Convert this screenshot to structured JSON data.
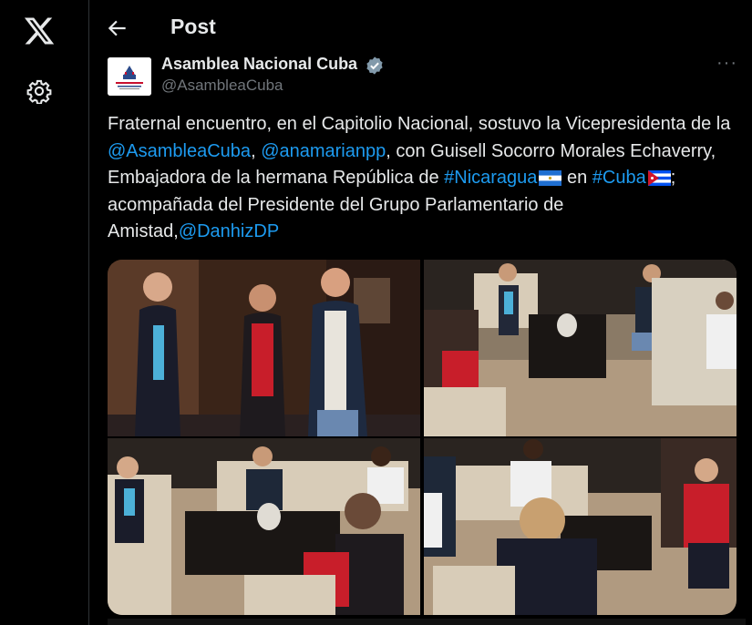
{
  "nav": {
    "logo_icon": "x-logo-icon",
    "settings_icon": "gear-icon"
  },
  "header": {
    "back_icon": "arrow-left-icon",
    "title": "Post"
  },
  "author": {
    "name": "Asamblea Nacional Cuba",
    "handle": "@AsambleaCuba",
    "verified_icon": "verified-badge-icon",
    "avatar_icon": "asamblea-logo-icon"
  },
  "more_label": "···",
  "tweet": {
    "t1": "Fraternal encuentro, en el Capitolio Nacional, sostuvo la Vicepresidenta de la ",
    "m1": "@AsambleaCuba",
    "t2": ", ",
    "m2": "@anamarianpp",
    "t3": ", con Guisell Socorro Morales Echaverry, Embajadora de la hermana República de ",
    "h1": "#Nicaragua",
    "t4": " en ",
    "h2": "#Cuba",
    "t5": "; acompañada del Presidente del Grupo Parlamentario de Amistad,",
    "m3": "@DanhizDP"
  },
  "colors": {
    "link": "#1d9bf0",
    "background": "#000000",
    "text": "#e7e9ea",
    "muted": "#71767b"
  }
}
